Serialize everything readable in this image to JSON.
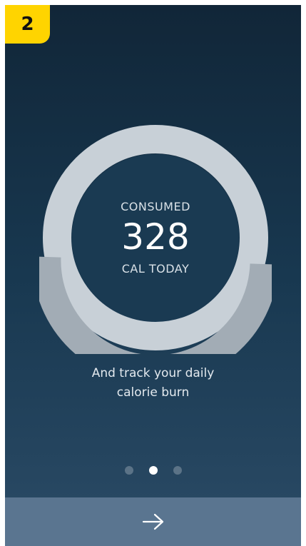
{
  "step_badge": {
    "number": "2"
  },
  "ring": {
    "label_top": "CONSUMED",
    "value": "328",
    "label_bottom": "CAL TODAY"
  },
  "tagline": {
    "line1": "And track your daily",
    "line2": "calorie burn"
  },
  "pager": {
    "count": 3,
    "active_index": 1
  },
  "next_button": {
    "icon": "arrow-right-icon"
  },
  "colors": {
    "badge": "#ffd400",
    "background_top": "#112638",
    "background_bottom": "#2b4b66",
    "ring_light": "#c6cfd6",
    "ring_dark": "#9ca7b0",
    "next_bar": "#5a7590"
  }
}
